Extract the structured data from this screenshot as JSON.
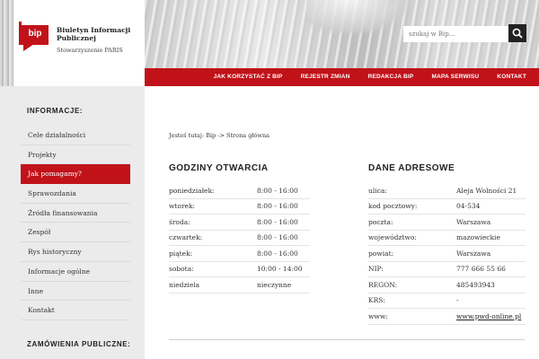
{
  "header": {
    "site_name": "Biuletyn Informacji Publicznej",
    "org_name": "Stowarzyszenie PARIS",
    "logo_text": "bip",
    "search_placeholder": "szukaj w Bip...",
    "search_icon": "search-icon"
  },
  "nav": [
    "JAK KORZYSTAĆ Z BIP",
    "REJESTR ZMIAN",
    "REDAKCJA BIP",
    "MAPA SERWISU",
    "KONTAKT"
  ],
  "sidebar": {
    "section_title": "INFORMACJE:",
    "items": [
      {
        "label": "Cele działalności"
      },
      {
        "label": "Projekty"
      },
      {
        "label": "Jak pomagamy?"
      },
      {
        "label": "Sprawozdania"
      },
      {
        "label": "Źródła finansowania"
      },
      {
        "label": "Zespół"
      },
      {
        "label": "Rys historyczny"
      },
      {
        "label": "Informacje ogólne"
      },
      {
        "label": "Inne"
      },
      {
        "label": "Kontakt"
      }
    ],
    "active_index": 2,
    "section2_title": "ZAMÓWIENIA PUBLICZNE:"
  },
  "breadcrumb": "Jesteś tutaj: Bip -> Strona główna",
  "hours": {
    "title": "GODZINY OTWARCIA",
    "rows": [
      {
        "day": "poniedziałek:",
        "time": "8:00 - 16:00"
      },
      {
        "day": "wtorek:",
        "time": "8:00 - 16:00"
      },
      {
        "day": "środa:",
        "time": "8:00 - 16:00"
      },
      {
        "day": "czwartek:",
        "time": "8:00 - 16:00"
      },
      {
        "day": "piątek:",
        "time": "8:00 - 16:00"
      },
      {
        "day": "sobota:",
        "time": "10:00 - 14:00"
      },
      {
        "day": "niedziela",
        "time": "nieczynne"
      }
    ]
  },
  "address": {
    "title": "DANE ADRESOWE",
    "rows": [
      {
        "key": "ulica:",
        "value": "Aleja Wolności 21"
      },
      {
        "key": "kod pocztowy:",
        "value": "04-534"
      },
      {
        "key": "poczta:",
        "value": "Warszawa"
      },
      {
        "key": "województwo:",
        "value": "mazowieckie"
      },
      {
        "key": "powiat:",
        "value": "Warszawa"
      },
      {
        "key": "NIP:",
        "value": "777 666 55 66"
      },
      {
        "key": "REGON:",
        "value": "485493943"
      },
      {
        "key": "KRS:",
        "value": "-"
      },
      {
        "key": "www:",
        "value": "www.pwd-online.pl"
      }
    ]
  },
  "colors": {
    "accent": "#c1121a",
    "sidebar_bg": "#ebebeb",
    "search_button": "#222222"
  }
}
